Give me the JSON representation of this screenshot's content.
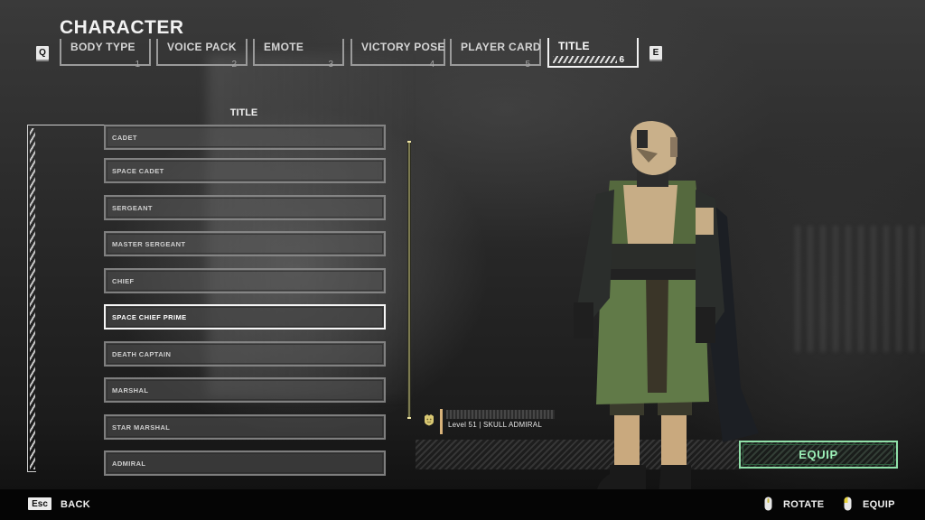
{
  "header": {
    "title": "CHARACTER",
    "prev_key": "Q",
    "next_key": "E"
  },
  "tabs": [
    {
      "label": "BODY TYPE",
      "number": "1",
      "active": false
    },
    {
      "label": "VOICE PACK",
      "number": "2",
      "active": false
    },
    {
      "label": "EMOTE",
      "number": "3",
      "active": false
    },
    {
      "label": "VICTORY POSE",
      "number": "4",
      "active": false
    },
    {
      "label": "PLAYER CARD",
      "number": "5",
      "active": false
    },
    {
      "label": "TITLE",
      "number": "6",
      "active": true
    }
  ],
  "title_panel": {
    "heading": "TITLE",
    "items": [
      {
        "label": "CADET",
        "selected": false
      },
      {
        "label": "SPACE CADET",
        "selected": false
      },
      {
        "label": "SERGEANT",
        "selected": false
      },
      {
        "label": "MASTER SERGEANT",
        "selected": false
      },
      {
        "label": "CHIEF",
        "selected": false
      },
      {
        "label": "SPACE CHIEF PRIME",
        "selected": true
      },
      {
        "label": "DEATH CAPTAIN",
        "selected": false
      },
      {
        "label": "MARSHAL",
        "selected": false
      },
      {
        "label": "STAR MARSHAL",
        "selected": false
      },
      {
        "label": "ADMIRAL",
        "selected": false
      }
    ]
  },
  "preview": {
    "icon": "rank-shield-icon",
    "text": "Level 51 | SKULL ADMIRAL"
  },
  "equip_button": {
    "label": "EQUIP"
  },
  "footer": {
    "back_key": "Esc",
    "back_label": "BACK",
    "rotate_label": "ROTATE",
    "equip_label": "EQUIP"
  },
  "colors": {
    "accent_green": "#9cf0b8",
    "gold": "#d8b27a",
    "selected_border": "#f5f5f5"
  }
}
